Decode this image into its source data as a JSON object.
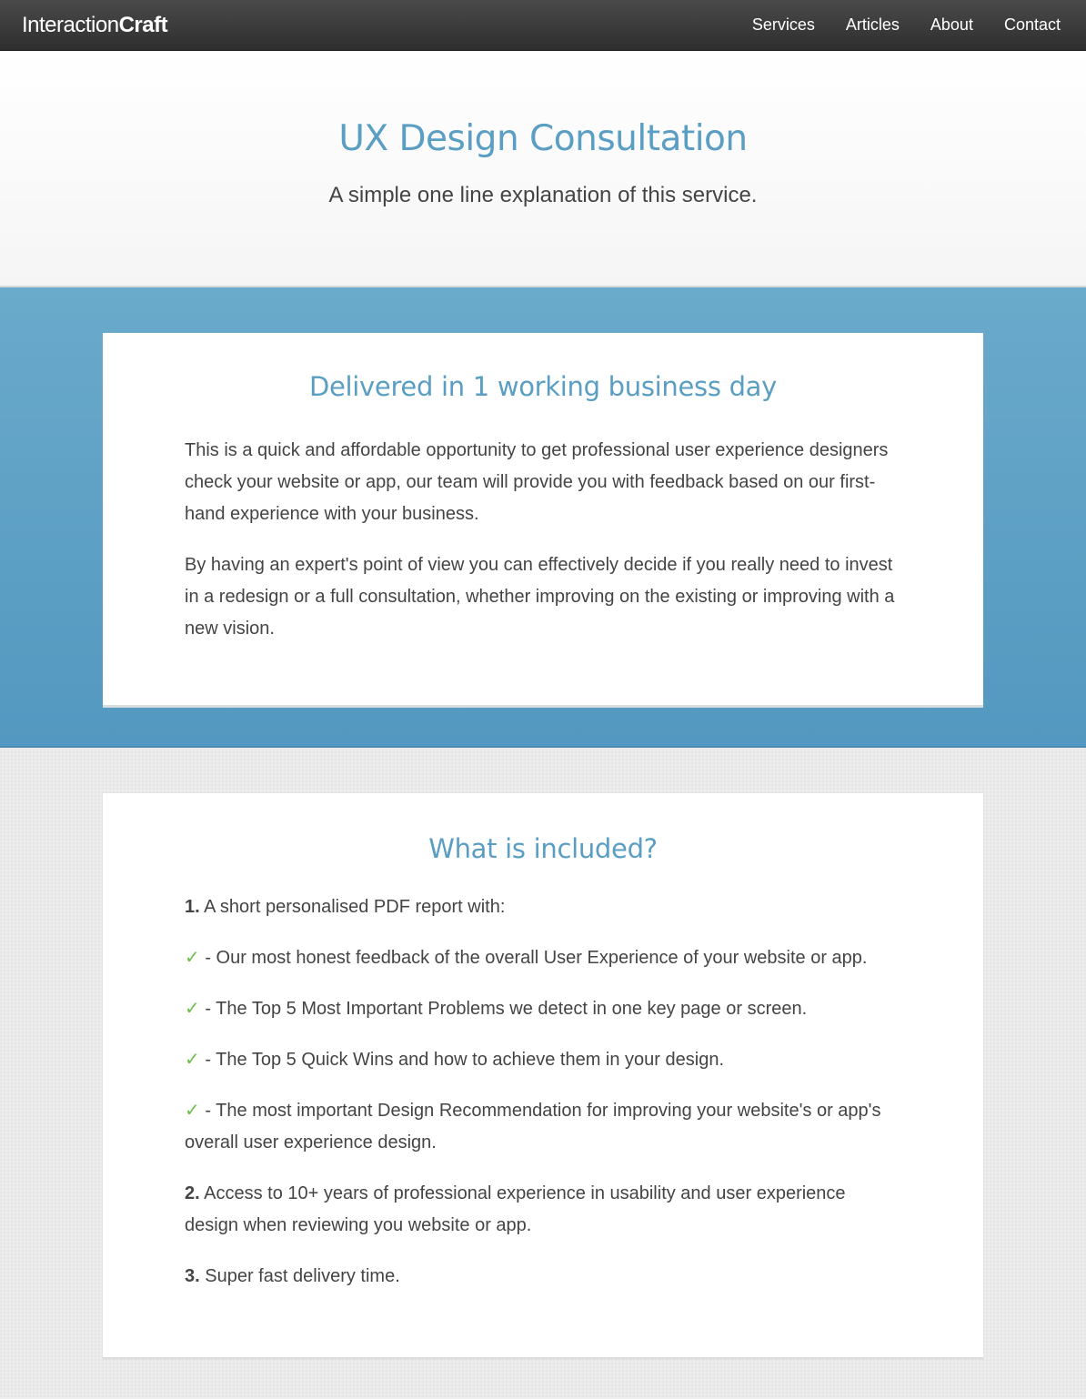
{
  "nav": {
    "brand_light": "Interaction",
    "brand_bold": "Craft",
    "links": [
      "Services",
      "Articles",
      "About",
      "Contact"
    ]
  },
  "hero": {
    "title": "UX Design Consultation",
    "subtitle": "A simple one line explanation of this service."
  },
  "delivery": {
    "heading": "Delivered in 1 working business day",
    "paragraphs": [
      "This is a quick and affordable opportunity to get professional user experience designers check your website or app, our team will provide you with feedback based on our first-hand experience with your business.",
      "By having an expert's point of view you can effectively decide if you really need to invest in a redesign or a full consultation, whether improving on the existing or improving with a new vision."
    ]
  },
  "included": {
    "heading": "What is included?",
    "item1": {
      "num": "1.",
      "text": " A short personalised PDF report with:"
    },
    "check_glyph": "✓",
    "checks": [
      " - Our most honest feedback of the overall User Experience of your website or app.",
      " - The Top 5 Most Important Problems we detect in one key page or screen.",
      " - The Top 5 Quick Wins and how to achieve them in your design.",
      " - The most important Design Recommendation for improving your website's or app's overall user experience design."
    ],
    "item2": {
      "num": "2.",
      "text": " Access to 10+ years of professional experience in usability and user experience design when reviewing you website or app."
    },
    "item3": {
      "num": "3.",
      "text": " Super fast delivery time."
    }
  },
  "colors": {
    "accent": "#5a9ec4",
    "band": "#5d9fc6",
    "check": "#6cc04a",
    "nav": "#3a3a3a"
  }
}
